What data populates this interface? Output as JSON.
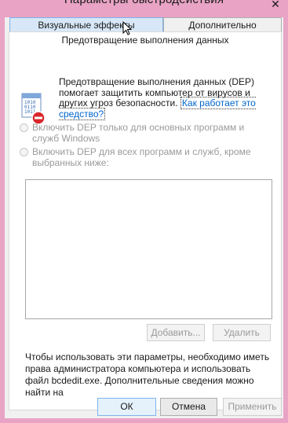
{
  "window": {
    "title": "Параметры быстродействия",
    "close_glyph": "✕"
  },
  "tabs": [
    {
      "label": "Визуальные эффекты",
      "active": true
    },
    {
      "label": "Дополнительно",
      "active": false
    }
  ],
  "dep": {
    "section_title": "Предотвращение выполнения данных",
    "description": "Предотвращение выполнения данных (DEP) помогает защитить компьютер от вирусов и других угроз безопасности.",
    "link_text": "Как работает это средство?",
    "icon": "dep-shield-icon",
    "options": [
      {
        "label": "Включить DEP только для основных программ и служб Windows",
        "selected": false,
        "enabled": false
      },
      {
        "label": "Включить DEP для всех программ и служб, кроме выбранных ниже:",
        "selected": false,
        "enabled": false
      }
    ],
    "add_button": "Добавить...",
    "remove_button": "Удалить",
    "info_text": "Чтобы использовать эти параметры, необходимо иметь права администратора компьютера и использовать файл bcdedit.exe. Дополнительные сведения можно найти на"
  },
  "footer": {
    "ok": "ОК",
    "cancel": "Отмена",
    "apply": "Применить"
  },
  "colors": {
    "frame": "#e8a3c5",
    "link": "#0066cc",
    "disabled_text": "#9a9a9a"
  }
}
